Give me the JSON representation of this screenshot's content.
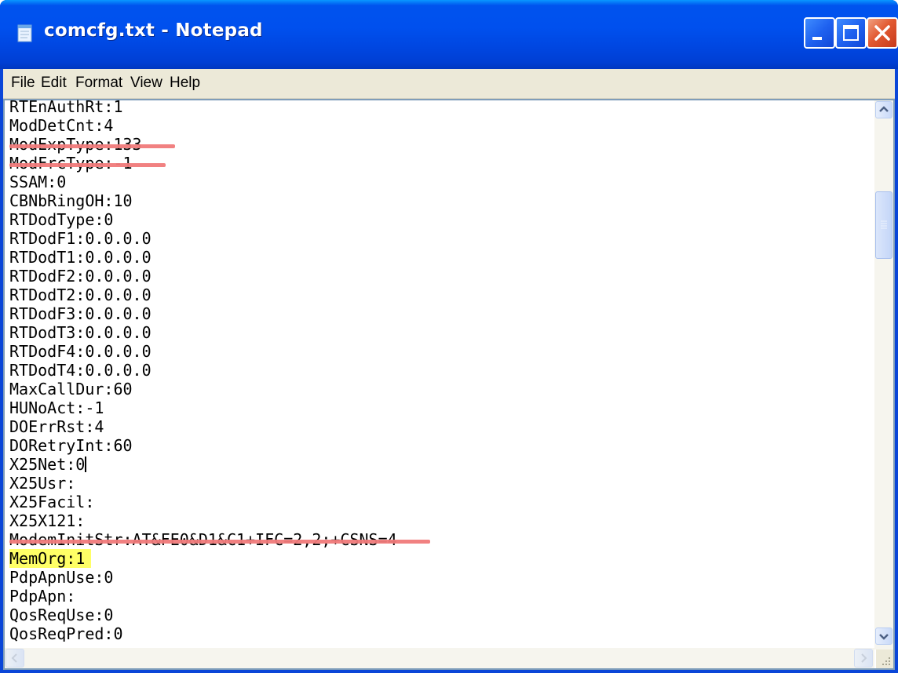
{
  "window": {
    "title": "comcfg.txt - Notepad",
    "colors": {
      "titlebar": "#0050ee",
      "strike": "#f07a7a",
      "highlight": "#ffff66"
    }
  },
  "menu": {
    "file": "File",
    "edit": "Edit",
    "format": "Format",
    "view": "View",
    "help": "Help"
  },
  "lines": [
    "RTEnAuthRt:1",
    "ModDetCnt:4",
    "ModExpType:133",
    "ModFrcType:-1",
    "SSAM:0",
    "CBNbRingOH:10",
    "RTDodType:0",
    "RTDodF1:0.0.0.0",
    "RTDodT1:0.0.0.0",
    "RTDodF2:0.0.0.0",
    "RTDodT2:0.0.0.0",
    "RTDodF3:0.0.0.0",
    "RTDodT3:0.0.0.0",
    "RTDodF4:0.0.0.0",
    "RTDodT4:0.0.0.0",
    "MaxCallDur:60",
    "HUNoAct:-1",
    "DOErrRst:4",
    "DORetryInt:60",
    "X25Net:0",
    "X25Usr:",
    "X25Facil:",
    "X25X121:",
    "ModemInitStr:AT&FE0&D1&C1+IFC=2,2;+CSNS=4",
    "MemOrg:1",
    "PdpApnUse:0",
    "PdpApn:",
    "QosReqUse:0",
    "QosReqPred:0"
  ],
  "annotations": {
    "struck_lines": [
      2,
      3,
      23
    ],
    "highlighted_lines": [
      24
    ],
    "caret_line": 19
  }
}
